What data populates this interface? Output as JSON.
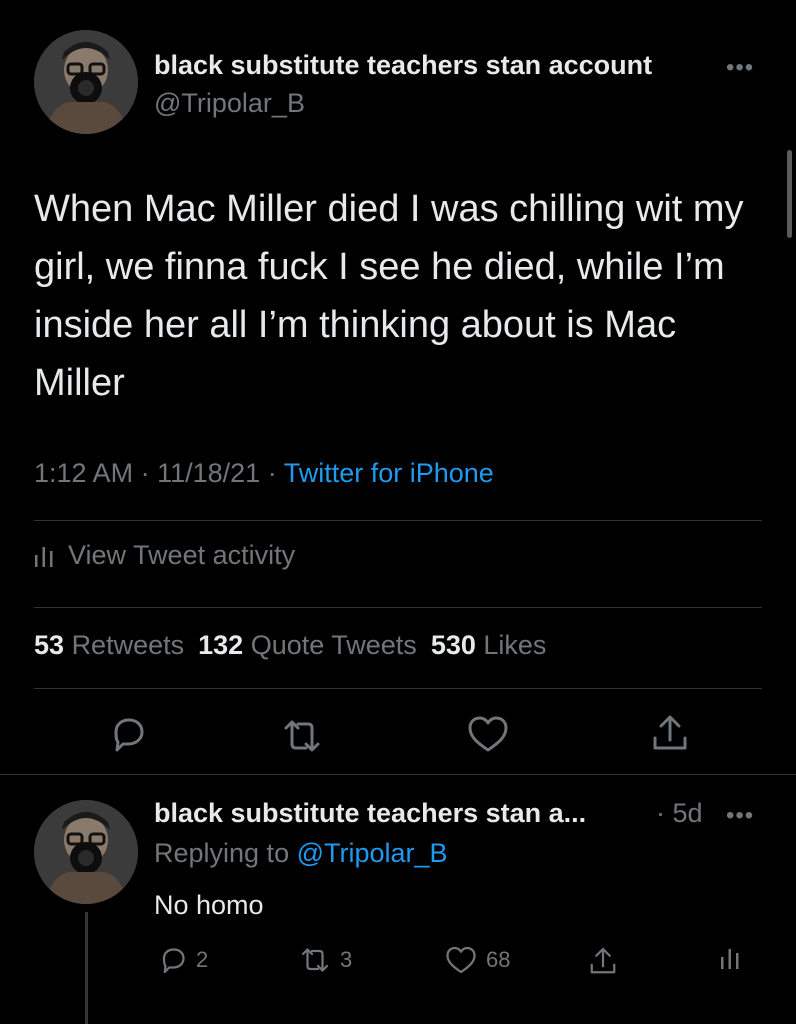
{
  "tweet": {
    "author_name": "black substitute teachers stan account",
    "author_handle": "@Tripolar_B",
    "more_label": "•••",
    "text": "When Mac Miller died I was chilling wit my girl, we finna fuck I see he died, while I’m inside her all I’m thinking about is Mac Miller",
    "time": "1:12 AM",
    "date": "11/18/21",
    "separator": "·",
    "source": "Twitter for iPhone",
    "activity_label": "View Tweet activity",
    "stats": {
      "retweets_count": "53",
      "retweets_label": "Retweets",
      "quotes_count": "132",
      "quotes_label": "Quote Tweets",
      "likes_count": "530",
      "likes_label": "Likes"
    },
    "actions": [
      "reply-icon",
      "retweet-icon",
      "like-icon",
      "share-icon"
    ]
  },
  "reply": {
    "author_name": "black substitute teachers stan a...",
    "age": "· 5d",
    "more_label": "•••",
    "replying_prefix": "Replying to",
    "replying_mention": "@Tripolar_B",
    "text": "No homo",
    "reply_count": "2",
    "retweet_count": "3",
    "like_count": "68"
  },
  "colors": {
    "background": "#000000",
    "text": "#e7e9ea",
    "muted": "#71767b",
    "link": "#1d9bf0",
    "divider": "#2f3336"
  }
}
